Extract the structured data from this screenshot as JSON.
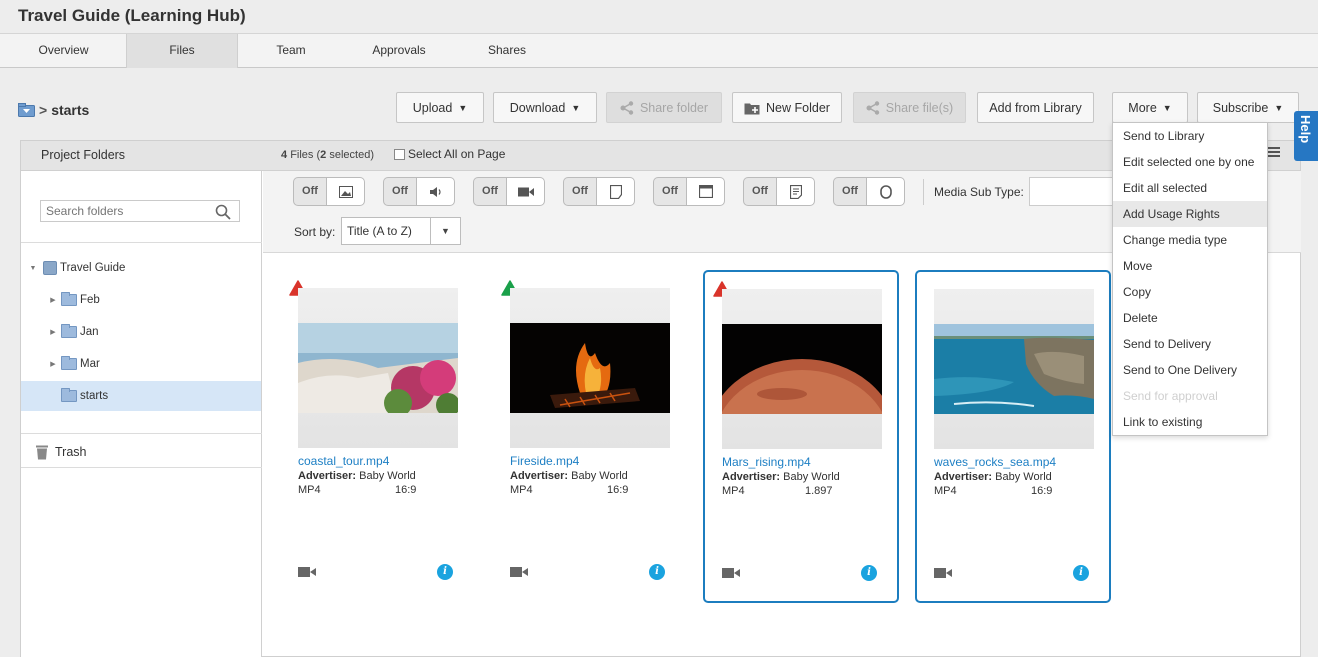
{
  "app": {
    "title": "Travel Guide (Learning Hub)"
  },
  "tabs": [
    {
      "label": "Overview"
    },
    {
      "label": "Files"
    },
    {
      "label": "Team"
    },
    {
      "label": "Approvals"
    },
    {
      "label": "Shares"
    }
  ],
  "breadcrumb": {
    "separator": ">",
    "current": "starts"
  },
  "actions": {
    "upload": "Upload",
    "download": "Download",
    "share_folder": "Share folder",
    "new_folder": "New Folder",
    "share_files": "Share file(s)",
    "add_from_library": "Add from Library",
    "more": "More",
    "subscribe": "Subscribe"
  },
  "panel": {
    "project_folders_label": "Project Folders",
    "file_count": "4",
    "files_word": "Files",
    "selected_count": "2",
    "selected_word": "selected",
    "select_all_label": "Select All on Page"
  },
  "sidebar": {
    "search_placeholder": "Search folders",
    "root": "Travel Guide",
    "folders": [
      {
        "label": "Feb"
      },
      {
        "label": "Jan"
      },
      {
        "label": "Mar"
      },
      {
        "label": "starts"
      }
    ],
    "trash_label": "Trash"
  },
  "filters": {
    "off_label": "Off",
    "toggles": [
      "image-icon",
      "audio-icon",
      "video-icon",
      "document-icon",
      "layout-icon",
      "text-document-icon",
      "other-icon"
    ],
    "media_sub_type_label": "Media Sub Type:",
    "sort_label": "Sort by:",
    "sort_value": "Title (A to Z)"
  },
  "files": [
    {
      "name": "coastal_tour.mp4",
      "advertiser_label": "Advertiser:",
      "advertiser": "Baby World",
      "format": "MP4",
      "ratio": "16:9",
      "status": "red",
      "selected": false
    },
    {
      "name": "Fireside.mp4",
      "advertiser_label": "Advertiser:",
      "advertiser": "Baby World",
      "format": "MP4",
      "ratio": "16:9",
      "status": "green",
      "selected": false
    },
    {
      "name": "Mars_rising.mp4",
      "advertiser_label": "Advertiser:",
      "advertiser": "Baby World",
      "format": "MP4",
      "ratio": "1.897",
      "status": "red",
      "selected": true
    },
    {
      "name": "waves_rocks_sea.mp4",
      "advertiser_label": "Advertiser:",
      "advertiser": "Baby World",
      "format": "MP4",
      "ratio": "16:9",
      "status": "none",
      "selected": true
    }
  ],
  "more_menu": {
    "items": [
      {
        "label": "Send to Library"
      },
      {
        "label": "Edit selected one by one"
      },
      {
        "label": "Edit all selected"
      },
      {
        "label": "Add Usage Rights"
      },
      {
        "label": "Change media type"
      },
      {
        "label": "Move"
      },
      {
        "label": "Copy"
      },
      {
        "label": "Delete"
      },
      {
        "label": "Send to Delivery"
      },
      {
        "label": "Send to One Delivery"
      },
      {
        "label": "Send for approval"
      },
      {
        "label": "Link to existing"
      }
    ]
  },
  "help": {
    "label": "Help"
  },
  "colors": {
    "link": "#1d7fc4",
    "selection_border": "#1c7dbf",
    "status_red": "#d9342b",
    "status_green": "#1aa04a",
    "help_tab": "#2677c3"
  }
}
